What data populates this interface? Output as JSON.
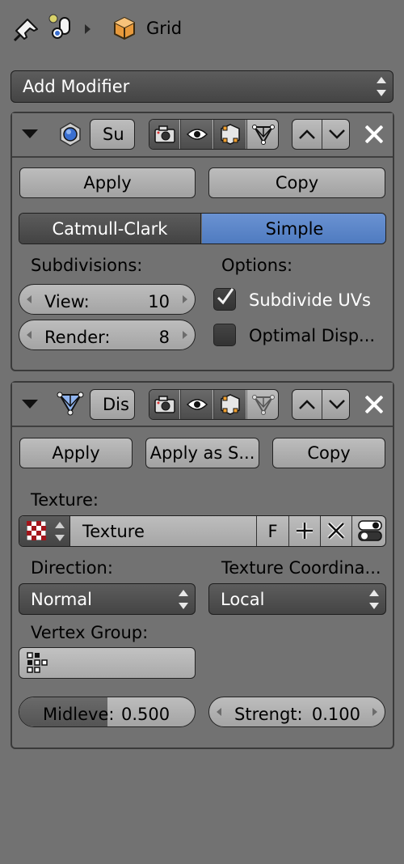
{
  "header": {
    "object_name": "Grid",
    "icons": [
      "pin-icon",
      "data-icon",
      "breadcrumb-arrow-icon",
      "cube-icon"
    ]
  },
  "add_modifier": {
    "label": "Add Modifier"
  },
  "modifier1": {
    "name": "Su",
    "apply_label": "Apply",
    "copy_label": "Copy",
    "method_options": [
      "Catmull-Clark",
      "Simple"
    ],
    "method_selected": "Simple",
    "subdivisions_label": "Subdivisions:",
    "options_label": "Options:",
    "view_label": "View:",
    "view_value": "10",
    "render_label": "Render:",
    "render_value": "8",
    "subdivide_uvs_label": "Subdivide UVs",
    "subdivide_uvs_checked": true,
    "optimal_disp_label": "Optimal Disp...",
    "optimal_disp_checked": false
  },
  "modifier2": {
    "name": "Dis",
    "apply_label": "Apply",
    "apply_shape_label": "Apply as S...",
    "copy_label": "Copy",
    "texture_label": "Texture:",
    "texture_value": "Texture",
    "fake_user_label": "F",
    "direction_label": "Direction:",
    "direction_value": "Normal",
    "texcoords_label": "Texture Coordina...",
    "texcoords_value": "Local",
    "vertex_group_label": "Vertex Group:",
    "vertex_group_value": "",
    "midlevel_label": "Midleve:",
    "midlevel_value": "0.500",
    "midlevel_fraction": 0.5,
    "strength_label": "Strengt:",
    "strength_value": "0.100"
  },
  "colors": {
    "background": "#727272",
    "selected": "#5680c2",
    "dark_button": "#4a4a4a"
  }
}
